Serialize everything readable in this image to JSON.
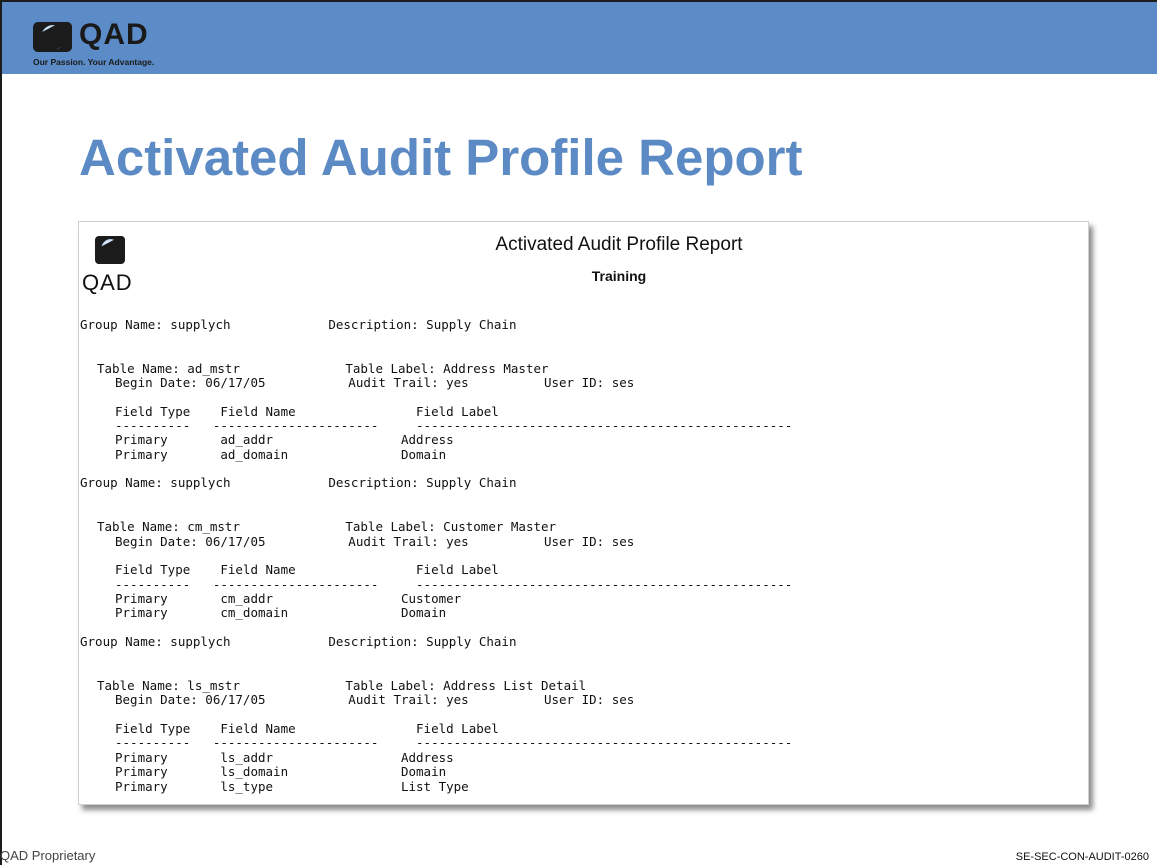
{
  "brand": {
    "name": "QAD",
    "tagline": "Our Passion. Your Advantage."
  },
  "slide": {
    "title": "Activated Audit Profile Report"
  },
  "report": {
    "logo_text": "QAD",
    "title": "Activated Audit Profile Report",
    "subtitle": "Training",
    "sections": [
      {
        "group_line": "Group Name: supplych             Description: Supply Chain",
        "table_line": "Table Name: ad_mstr              Table Label: Address Master",
        "begin_line": "Begin Date: 06/17/05           Audit Trail: yes          User ID: ses",
        "header_line": "Field Type    Field Name                Field Label",
        "rule_line": "----------   ----------------------     --------------------------------------------------",
        "rows": [
          "Primary       ad_addr                 Address",
          "Primary       ad_domain               Domain"
        ]
      },
      {
        "group_line": "Group Name: supplych             Description: Supply Chain",
        "table_line": "Table Name: cm_mstr              Table Label: Customer Master",
        "begin_line": "Begin Date: 06/17/05           Audit Trail: yes          User ID: ses",
        "header_line": "Field Type    Field Name                Field Label",
        "rule_line": "----------   ----------------------     --------------------------------------------------",
        "rows": [
          "Primary       cm_addr                 Customer",
          "Primary       cm_domain               Domain"
        ]
      },
      {
        "group_line": "Group Name: supplych             Description: Supply Chain",
        "table_line": "Table Name: ls_mstr              Table Label: Address List Detail",
        "begin_line": "Begin Date: 06/17/05           Audit Trail: yes          User ID: ses",
        "header_line": "Field Type    Field Name                Field Label",
        "rule_line": "----------   ----------------------     --------------------------------------------------",
        "rows": [
          "Primary       ls_addr                 Address",
          "Primary       ls_domain               Domain",
          "Primary       ls_type                 List Type"
        ]
      }
    ]
  },
  "footer": {
    "left": "QAD Proprietary",
    "right": "SE-SEC-CON-AUDIT-0260"
  }
}
